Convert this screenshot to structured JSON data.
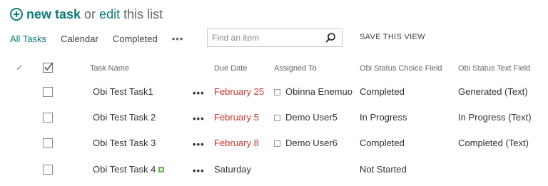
{
  "header": {
    "new_task_label": "new task",
    "or_text": "or",
    "edit_label": "edit",
    "this_list_text": "this list"
  },
  "views": {
    "items": [
      "All Tasks",
      "Calendar",
      "Completed"
    ],
    "more_label": "•••",
    "active_index": 0
  },
  "search": {
    "placeholder": "Find an item",
    "value": ""
  },
  "save_view_label": "SAVE THIS VIEW",
  "table": {
    "columns": {
      "checkmark": "✓",
      "task_name": "Task Name",
      "due_date": "Due Date",
      "assigned_to": "Assigned To",
      "status_choice": "Obi Status Choice Field",
      "status_text": "Obi Status Text Field"
    },
    "rows": [
      {
        "task_name": "Obi Test Task1",
        "actions": "•••",
        "due_date": "February 25",
        "due_overdue": true,
        "assigned_to": "Obinna Enemuo",
        "status_choice": "Completed",
        "status_text": "Generated (Text)"
      },
      {
        "task_name": "Obi Test Task 2",
        "actions": "•••",
        "due_date": "February 5",
        "due_overdue": true,
        "assigned_to": "Demo User5",
        "status_choice": "In Progress",
        "status_text": "In Progress (Text)"
      },
      {
        "task_name": "Obi Test Task 3",
        "actions": "•••",
        "due_date": "February 8",
        "due_overdue": true,
        "assigned_to": "Demo User6",
        "status_choice": "Completed",
        "status_text": "Completed (Text)"
      },
      {
        "task_name": "Obi Test Task 4",
        "actions": "•••",
        "due_date": "Saturday",
        "due_overdue": false,
        "assigned_to": "",
        "status_choice": "Not Started",
        "status_text": ""
      }
    ]
  },
  "colors": {
    "accent": "#0e7b7b",
    "overdue": "#c4362b",
    "new_badge": "#6bb35c"
  },
  "icons": {
    "new_task": "plus-circle-icon",
    "search": "magnifier-icon",
    "new_item": "new-item-icon"
  }
}
